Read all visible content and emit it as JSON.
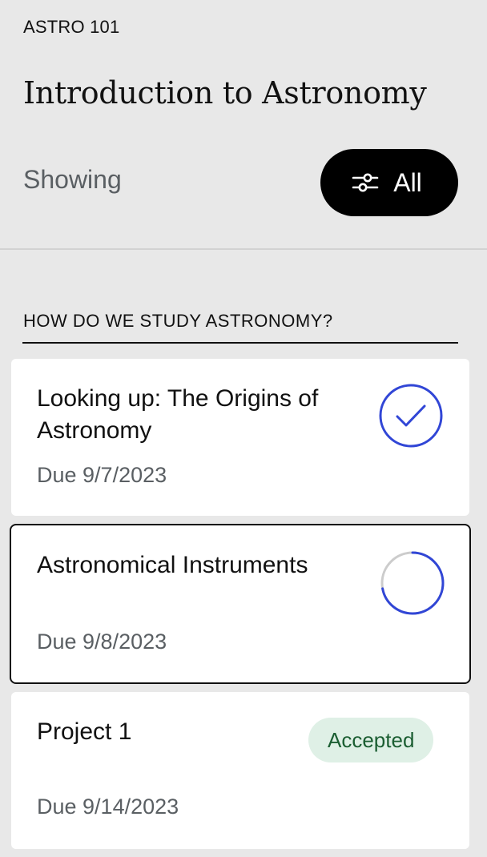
{
  "course": {
    "code": "ASTRO 101",
    "title": "Introduction to Astronomy"
  },
  "filter": {
    "showing_label": "Showing",
    "value": "All",
    "icon": "filter-sliders-icon"
  },
  "section": {
    "heading": "HOW DO WE STUDY ASTRONOMY?"
  },
  "assignments": [
    {
      "title": "Looking up: The Origins of Astronomy",
      "due": "Due 9/7/2023",
      "status": "completed",
      "status_icon": "checkmark-circle-icon"
    },
    {
      "title": "Astronomical Instruments",
      "due": "Due 9/8/2023",
      "status": "in-progress",
      "status_icon": "progress-ring-icon",
      "progress": 0.72
    },
    {
      "title": "Project 1",
      "due": "Due 9/14/2023",
      "status": "accepted",
      "badge": "Accepted"
    }
  ],
  "colors": {
    "accent": "#3146d6",
    "progress_track": "#cccccc",
    "badge_bg": "#dff0e6",
    "badge_text": "#1b5e32",
    "background": "#e8e8e8"
  }
}
